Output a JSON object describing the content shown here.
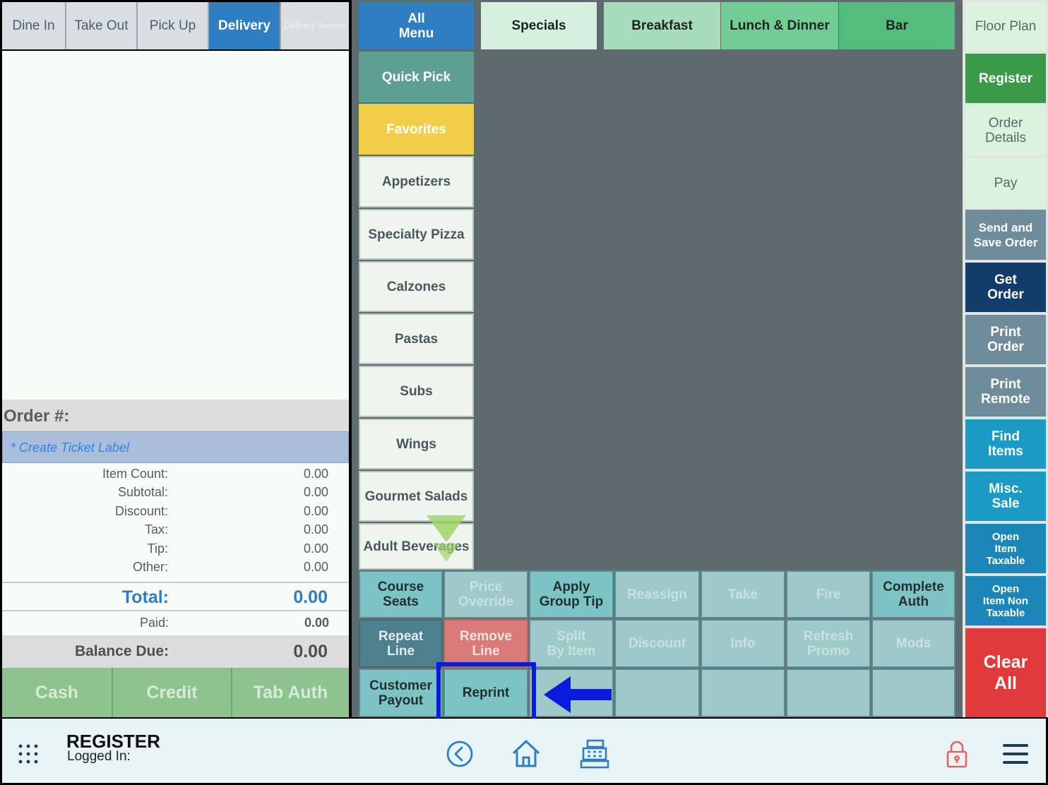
{
  "order_type_tabs": [
    {
      "label": "Dine In"
    },
    {
      "label": "Take Out"
    },
    {
      "label": "Pick Up"
    },
    {
      "label": "Delivery"
    },
    {
      "label": "Delivery Service"
    }
  ],
  "order": {
    "order_number_label": "Order #:",
    "ticket_label_placeholder": "* Create Ticket Label",
    "summary": [
      {
        "label": "Item Count:",
        "value": "0.00"
      },
      {
        "label": "Subtotal:",
        "value": "0.00"
      },
      {
        "label": "Discount:",
        "value": "0.00"
      },
      {
        "label": "Tax:",
        "value": "0.00"
      },
      {
        "label": "Tip:",
        "value": "0.00"
      },
      {
        "label": "Other:",
        "value": "0.00"
      }
    ],
    "total_label": "Total:",
    "total_value": "0.00",
    "paid_label": "Paid:",
    "paid_value": "0.00",
    "balance_label": "Balance Due:",
    "balance_value": "0.00"
  },
  "payment_buttons": {
    "cash": "Cash",
    "credit": "Credit",
    "tab_auth": "Tab Auth"
  },
  "menu": {
    "all_menu": [
      "All",
      "Menu"
    ],
    "top_categories": [
      "Specials",
      "Breakfast",
      "Lunch & Dinner",
      "Bar"
    ],
    "quick_pick": "Quick Pick",
    "favorites": "Favorites",
    "categories": [
      "Appetizers",
      "Specialty Pizza",
      "Calzones",
      "Pastas",
      "Subs",
      "Wings",
      "Gourmet Salads",
      "Adult Beverages"
    ]
  },
  "right_panel": {
    "floor_plan": "Floor Plan",
    "register": "Register",
    "order_details": [
      "Order",
      "Details"
    ],
    "pay": "Pay",
    "send_and_save": [
      "Send and",
      "Save Order"
    ],
    "get_order": [
      "Get",
      "Order"
    ],
    "print_order": [
      "Print",
      "Order"
    ],
    "print_remote": [
      "Print",
      "Remote"
    ],
    "find_items": [
      "Find",
      "Items"
    ],
    "misc_sale": [
      "Misc.",
      "Sale"
    ],
    "open_item_taxable": [
      "Open",
      "Item",
      "Taxable"
    ],
    "open_item_non_taxable": [
      "Open",
      "Item Non",
      "Taxable"
    ],
    "clear_all": [
      "Clear",
      "All"
    ]
  },
  "actions": {
    "course_seats": [
      "Course",
      "Seats"
    ],
    "price_override": [
      "Price",
      "Override"
    ],
    "apply_group_tip": [
      "Apply",
      "Group Tip"
    ],
    "reassign": "Reassign",
    "take": "Take",
    "fire": "Fire",
    "complete_auth": [
      "Complete",
      "Auth"
    ],
    "repeat_line": [
      "Repeat",
      "Line"
    ],
    "remove_line": [
      "Remove",
      "Line"
    ],
    "split_by_item": [
      "Split",
      "By Item"
    ],
    "discount": "Discount",
    "info": "Info",
    "refresh_promo": [
      "Refresh",
      "Promo"
    ],
    "mods": "Mods",
    "customer_payout": [
      "Customer",
      "Payout"
    ],
    "reprint": "Reprint"
  },
  "footer": {
    "title": "REGISTER",
    "logged_in": "Logged In:"
  },
  "colors": {
    "accent_blue": "#2e7ec1",
    "favorites_yellow": "#f2cd4a",
    "register_green": "#3a9a4a",
    "clear_all_red": "#e03a3a",
    "highlight_box": "#0a1adf"
  }
}
